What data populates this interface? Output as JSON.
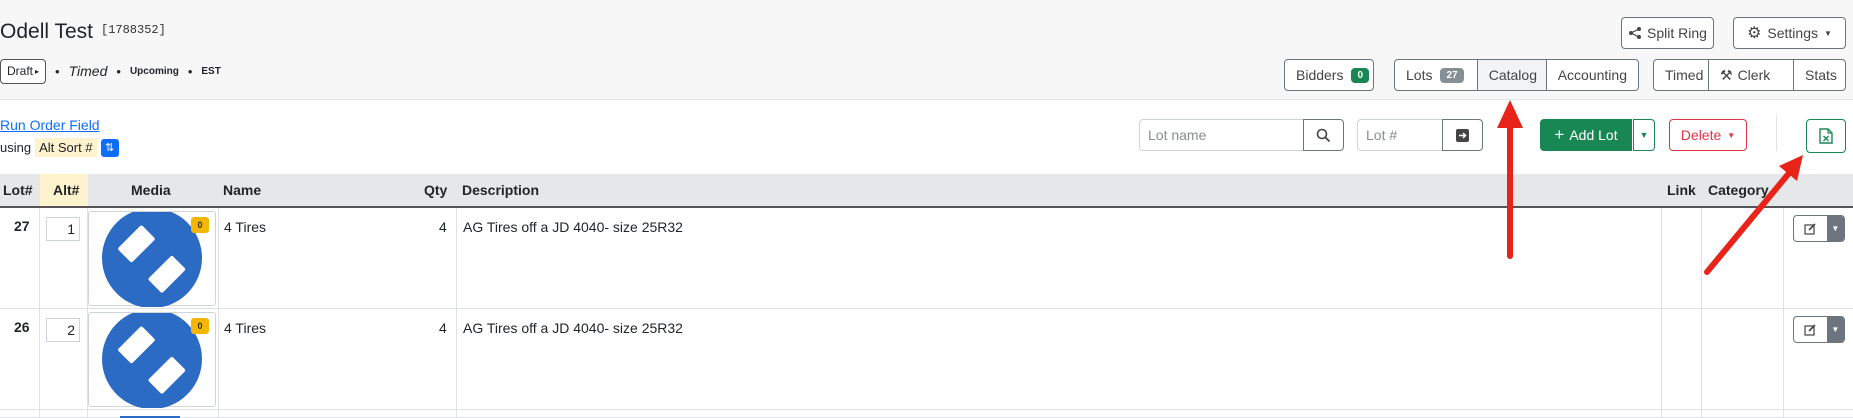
{
  "header": {
    "title": "Odell Test",
    "auction_id": "[1788352]",
    "status": {
      "draft": "Draft",
      "timed": "Timed",
      "upcoming": "Upcoming",
      "tz": "EST"
    }
  },
  "top_buttons": {
    "split_ring": "Split Ring",
    "settings": "Settings"
  },
  "nav": {
    "bidders": "Bidders",
    "bidders_count": "0",
    "lots": "Lots",
    "lots_count": "27",
    "catalog": "Catalog",
    "accounting": "Accounting",
    "timed": "Timed",
    "clerk": "Clerk",
    "stats": "Stats"
  },
  "sort": {
    "link": "Run Order Field",
    "using": "using",
    "field": "Alt Sort #"
  },
  "search": {
    "lot_name_placeholder": "Lot name",
    "lot_num_placeholder": "Lot #"
  },
  "actions": {
    "add_lot": "Add Lot",
    "delete": "Delete"
  },
  "table": {
    "columns": {
      "lot": "Lot#",
      "alt": "Alt#",
      "media": "Media",
      "name": "Name",
      "qty": "Qty",
      "description": "Description",
      "link": "Link",
      "category": "Category"
    },
    "rows": [
      {
        "lot": "27",
        "alt": "1",
        "media_count": "0",
        "name": "4 Tires",
        "qty": "4",
        "description": "AG Tires off a JD 4040- size 25R32"
      },
      {
        "lot": "26",
        "alt": "2",
        "media_count": "0",
        "name": "4 Tires",
        "qty": "4",
        "description": "AG Tires off a JD 4040- size 25R32"
      }
    ]
  },
  "colors": {
    "primary": "#0d6efd",
    "success": "#198754",
    "danger": "#dc3545",
    "annotation": "#e8231a"
  }
}
